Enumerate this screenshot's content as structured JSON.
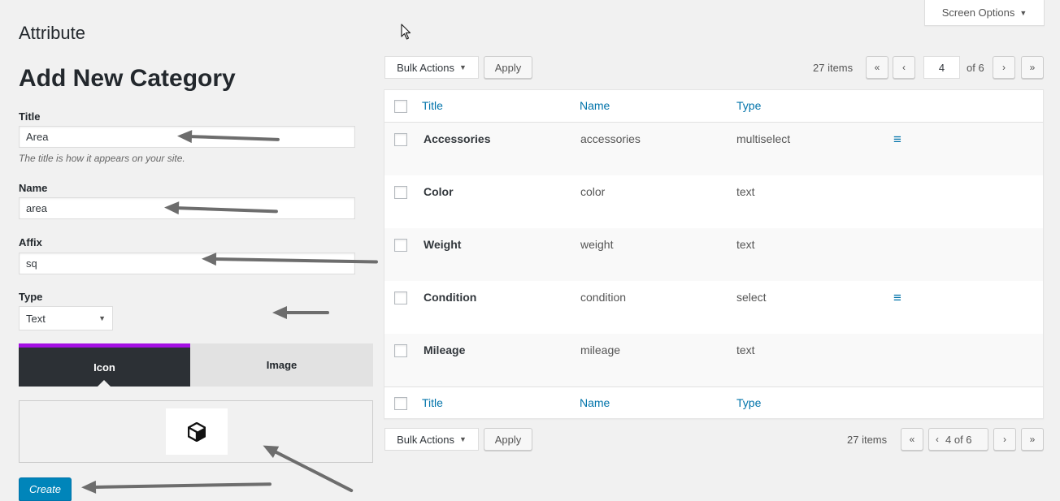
{
  "screen_options": {
    "label": "Screen Options",
    "caret": "▼"
  },
  "page_title": "Attribute",
  "form": {
    "heading": "Add New Category",
    "title_label": "Title",
    "title_value": "Area",
    "title_help": "The title is how it appears on your site.",
    "name_label": "Name",
    "name_value": "area",
    "affix_label": "Affix",
    "affix_value": "sq",
    "type_label": "Type",
    "type_value": "Text",
    "type_caret": "▼",
    "tabs": {
      "icon": "Icon",
      "image": "Image"
    },
    "tab_accent": "#a40fe3",
    "preview_icon": "cube-icon",
    "create_label": "Create"
  },
  "toolbar_top": {
    "bulk_label": "Bulk Actions",
    "bulk_caret": "▼",
    "apply_label": "Apply",
    "items_count": "27 items",
    "first": "«",
    "prev": "‹",
    "current_page": "4",
    "of_pages": "of 6",
    "next": "›",
    "last": "»"
  },
  "table": {
    "columns": [
      "Title",
      "Name",
      "Type"
    ],
    "rows": [
      {
        "title": "Accessories",
        "name": "accessories",
        "type": "multiselect",
        "menu": "≡"
      },
      {
        "title": "Color",
        "name": "color",
        "type": "text",
        "menu": ""
      },
      {
        "title": "Weight",
        "name": "weight",
        "type": "text",
        "menu": ""
      },
      {
        "title": "Condition",
        "name": "condition",
        "type": "select",
        "menu": "≡"
      },
      {
        "title": "Mileage",
        "name": "mileage",
        "type": "text",
        "menu": ""
      }
    ]
  },
  "toolbar_bottom": {
    "bulk_label": "Bulk Actions",
    "bulk_caret": "▼",
    "apply_label": "Apply",
    "items_count": "27 items",
    "first": "«",
    "prev": "‹",
    "page_text": "4 of 6",
    "next": "›",
    "last": "»"
  },
  "colors": {
    "link": "#0073aa",
    "primary_button": "#0085ba",
    "tab_dark": "#2c3035"
  }
}
